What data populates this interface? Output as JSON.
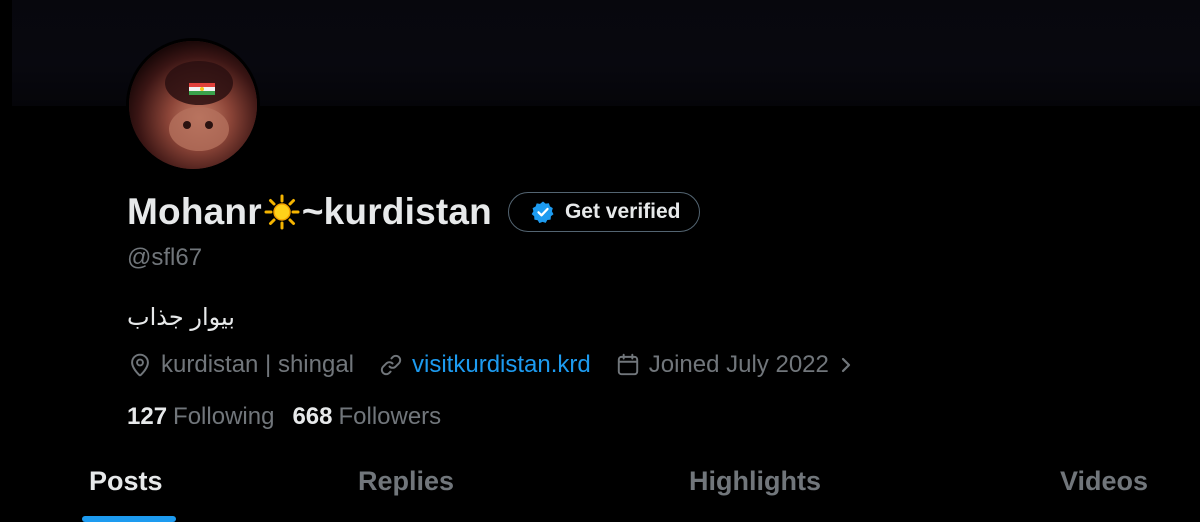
{
  "profile": {
    "display_name_prefix": "Mohanr",
    "display_name_emoji": "sun-emoji",
    "display_name_suffix": "~kurdistan",
    "handle": "@sfl67",
    "bio": "بيوار جذاب",
    "get_verified_label": "Get verified",
    "location": "kurdistan | shingal",
    "website": "visitkurdistan.krd",
    "joined": "Joined July 2022"
  },
  "stats": {
    "following_count": "127",
    "following_label": "Following",
    "followers_count": "668",
    "followers_label": "Followers"
  },
  "tabs": [
    {
      "label": "Posts",
      "active": true
    },
    {
      "label": "Replies",
      "active": false
    },
    {
      "label": "Highlights",
      "active": false
    },
    {
      "label": "Videos",
      "active": false
    }
  ],
  "colors": {
    "background": "#000000",
    "text_primary": "#e7e9ea",
    "text_secondary": "#71767b",
    "accent": "#1d9bf0",
    "verified_badge": "#1d9bf0"
  },
  "icons": {
    "location": "location-pin-icon",
    "website": "link-icon",
    "joined": "calendar-icon",
    "joined_chevron": "chevron-right-icon",
    "verified": "verified-badge-icon"
  }
}
